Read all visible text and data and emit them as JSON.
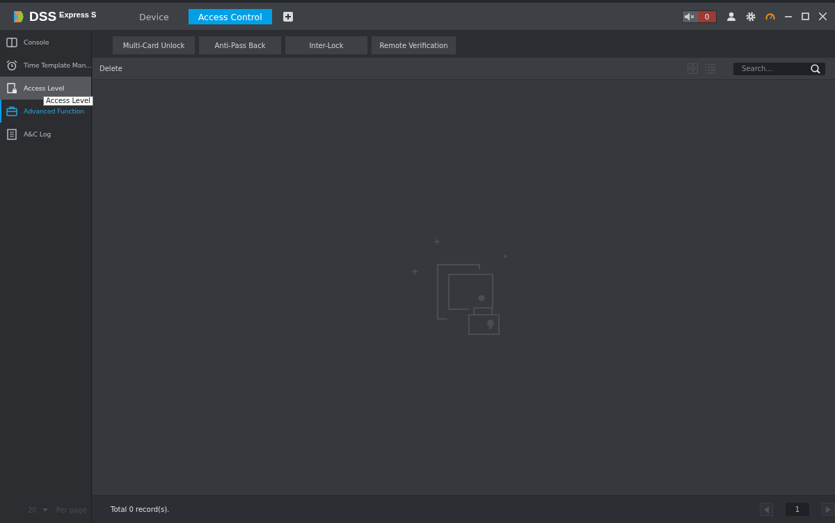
{
  "app": {
    "logo": "DSS",
    "edition": "Express S"
  },
  "top_tabs": [
    {
      "label": "Device",
      "selected": false
    },
    {
      "label": "Access Control",
      "selected": true
    }
  ],
  "top_bar": {
    "alarm_count": "0"
  },
  "sidebar": {
    "items": [
      {
        "label": "Console",
        "kind": "console",
        "selected": false,
        "hover": false
      },
      {
        "label": "Time Template Man...",
        "kind": "clock",
        "selected": false,
        "hover": false
      },
      {
        "label": "Access Level",
        "kind": "door",
        "selected": false,
        "hover": true
      },
      {
        "label": "Advanced Function",
        "kind": "case",
        "selected": true,
        "hover": false
      },
      {
        "label": "A&C Log",
        "kind": "log",
        "selected": false,
        "hover": false
      }
    ],
    "tooltip": "Access Level",
    "page_size": "20",
    "per_page": "Per page"
  },
  "tabs": [
    {
      "label": "Multi-Card Unlock",
      "selected": false
    },
    {
      "label": "Anti-Pass Back",
      "selected": false
    },
    {
      "label": "Inter-Lock",
      "selected": false
    },
    {
      "label": "Remote Verification",
      "selected": false
    }
  ],
  "toolbar": {
    "delete": "Delete",
    "search": {
      "placeholder": "Search..."
    }
  },
  "footer": {
    "total": "Total 0 record(s).",
    "page": "1"
  }
}
